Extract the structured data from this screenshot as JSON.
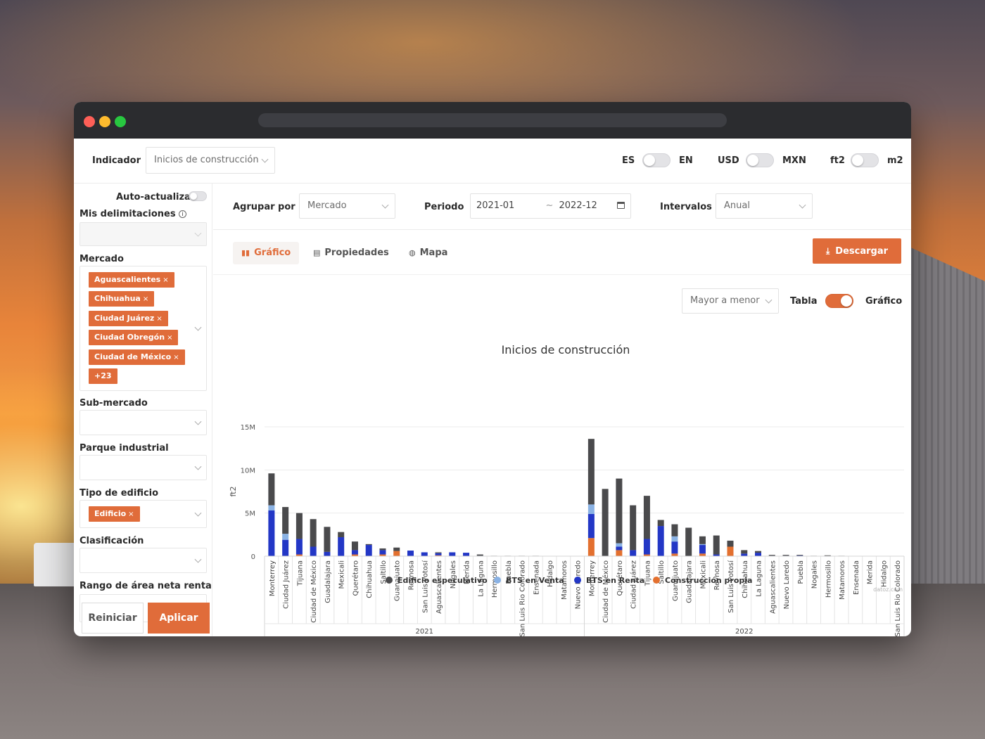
{
  "topbar": {
    "indicator_label": "Indicador",
    "indicator_value": "Inicios de construcción",
    "lang_left": "ES",
    "lang_right": "EN",
    "currency_left": "USD",
    "currency_right": "MXN",
    "unit_left": "ft2",
    "unit_right": "m2"
  },
  "sidebar": {
    "auto_update_label": "Auto-actualizar",
    "my_boundaries_label": "Mis delimitaciones",
    "market_label": "Mercado",
    "market_tags": [
      "Aguascalientes",
      "Chihuahua",
      "Ciudad Juárez",
      "Ciudad Obregón",
      "Ciudad de México"
    ],
    "market_more": "+23",
    "submarket_label": "Sub-mercado",
    "industrial_park_label": "Parque industrial",
    "building_type_label": "Tipo de edificio",
    "building_type_tag": "Edificio",
    "classification_label": "Clasificación",
    "area_range_label": "Rango de área neta rentable",
    "reset_label": "Reiniciar",
    "apply_label": "Aplicar"
  },
  "filters": {
    "group_by_label": "Agrupar por",
    "group_by_value": "Mercado",
    "period_label": "Periodo",
    "period_start": "2021-01",
    "period_separator": "~",
    "period_end": "2022-12",
    "intervals_label": "Intervalos",
    "intervals_value": "Anual"
  },
  "tabs": {
    "chart": "Gráfico",
    "properties": "Propiedades",
    "map": "Mapa",
    "download": "Descargar"
  },
  "chart_controls": {
    "sort_value": "Mayor a menor",
    "view_left": "Tabla",
    "view_right": "Gráfico"
  },
  "watermark": "datoz.com",
  "colors": {
    "accent": "#e06c3a",
    "speculative": "#4a4a4c",
    "bts_sale": "#8ab2e4",
    "bts_rent": "#2337c6",
    "own": "#e3702f"
  },
  "chart_data": {
    "type": "bar",
    "stacked": true,
    "title": "Inicios de construcción",
    "ylabel": "ft2",
    "ylim": [
      0,
      15000000
    ],
    "y_ticks": [
      {
        "value": 0,
        "label": "0"
      },
      {
        "value": 5000000,
        "label": "5M"
      },
      {
        "value": 10000000,
        "label": "10M"
      },
      {
        "value": 15000000,
        "label": "15M"
      }
    ],
    "grid": true,
    "legend_position": "bottom",
    "groups": [
      {
        "label": "2021",
        "categories": [
          "Monterrey",
          "Ciudad Juárez",
          "Tijuana",
          "Ciudad de México",
          "Guadalajara",
          "Mexicali",
          "Querétaro",
          "Chihuahua",
          "Saltillo",
          "Guanajuato",
          "Reynosa",
          "San Luis Potosí",
          "Aguascalientes",
          "Nogales",
          "Merida",
          "La Laguna",
          "Hermosillo",
          "Puebla",
          "San Luis Rio Colorado",
          "Ensenada",
          "Hidalgo",
          "Matamoros",
          "Nuevo Laredo"
        ]
      },
      {
        "label": "2022",
        "categories": [
          "Monterrey",
          "Ciudad de México",
          "Querétaro",
          "Ciudad Juárez",
          "Tijuana",
          "Saltillo",
          "Guanajuato",
          "Guadalajara",
          "Mexicali",
          "Reynosa",
          "San Luis Potosí",
          "Chihuahua",
          "La Laguna",
          "Aguascalientes",
          "Nuevo Laredo",
          "Puebla",
          "Nogales",
          "Hermosillo",
          "Matamoros",
          "Ensenada",
          "Merida",
          "Hidalgo",
          "San Luis Rio Colorado"
        ]
      }
    ],
    "series": [
      {
        "name": "Edificio especulativo",
        "color": "#4a4a4c",
        "values": [
          3700000,
          3100000,
          3000000,
          3200000,
          2900000,
          600000,
          1000000,
          100000,
          200000,
          400000,
          0,
          0,
          100000,
          0,
          0,
          150000,
          50000,
          50000,
          50000,
          50000,
          0,
          0,
          0,
          7600000,
          7800000,
          7500000,
          5200000,
          5000000,
          700000,
          1400000,
          3300000,
          900000,
          2200000,
          700000,
          400000,
          200000,
          100000,
          100000,
          50000,
          50000,
          100000,
          50000,
          0,
          0,
          0,
          0
        ]
      },
      {
        "name": "BTS en Venta",
        "color": "#8ab2e4",
        "values": [
          600000,
          700000,
          0,
          0,
          0,
          0,
          0,
          0,
          0,
          0,
          0,
          0,
          0,
          0,
          0,
          0,
          0,
          0,
          0,
          0,
          0,
          0,
          0,
          1100000,
          0,
          400000,
          0,
          0,
          0,
          600000,
          0,
          100000,
          0,
          0,
          0,
          0,
          0,
          0,
          0,
          0,
          0,
          0,
          0,
          0,
          0,
          0
        ]
      },
      {
        "name": "BTS en Renta",
        "color": "#2337c6",
        "values": [
          5300000,
          1900000,
          1800000,
          1100000,
          500000,
          2200000,
          500000,
          1300000,
          500000,
          0,
          650000,
          450000,
          250000,
          450000,
          400000,
          50000,
          0,
          0,
          0,
          0,
          0,
          0,
          0,
          2800000,
          0,
          400000,
          700000,
          1800000,
          3500000,
          1400000,
          0,
          1000000,
          200000,
          0,
          300000,
          400000,
          50000,
          50000,
          100000,
          0,
          0,
          0,
          0,
          0,
          0,
          0
        ]
      },
      {
        "name": "Construcción propia",
        "color": "#e3702f",
        "values": [
          0,
          0,
          200000,
          0,
          0,
          0,
          200000,
          0,
          200000,
          600000,
          0,
          0,
          100000,
          0,
          0,
          0,
          0,
          0,
          0,
          0,
          0,
          0,
          0,
          2100000,
          0,
          700000,
          0,
          200000,
          0,
          300000,
          0,
          300000,
          0,
          1100000,
          0,
          0,
          0,
          0,
          0,
          0,
          0,
          0,
          0,
          0,
          0,
          0
        ]
      }
    ]
  }
}
